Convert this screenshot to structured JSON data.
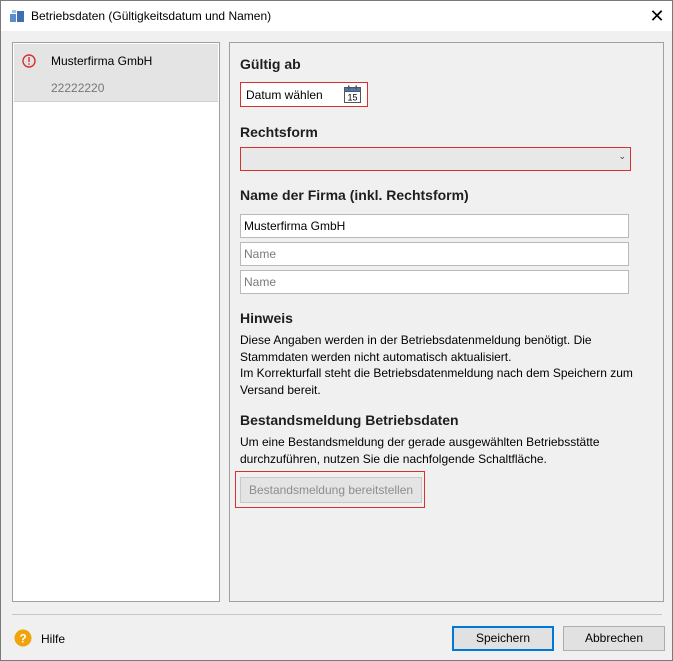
{
  "window": {
    "title": "Betriebsdaten (Gültigkeitsdatum und Namen)",
    "close_glyph": "✕"
  },
  "sidebar": {
    "items": [
      {
        "name": "Musterfirma GmbH",
        "number": "22222220",
        "status_icon": "error-circle-icon"
      }
    ]
  },
  "form": {
    "valid_from": {
      "heading": "Gültig ab",
      "date_label": "Datum wählen",
      "calendar_day": "15"
    },
    "legal_form": {
      "heading": "Rechtsform",
      "selected": ""
    },
    "company_name": {
      "heading": "Name der Firma (inkl. Rechtsform)",
      "line1_value": "Musterfirma GmbH",
      "line2_placeholder": "Name",
      "line3_placeholder": "Name"
    },
    "note": {
      "heading": "Hinweis",
      "line1": "Diese Angaben werden in der Betriebsdatenmeldung benötigt. Die",
      "line2": "Stammdaten werden nicht automatisch aktualisiert.",
      "line3": "Im Korrekturfall steht die Betriebsdatenmeldung nach dem Speichern zum",
      "line4": "Versand bereit."
    },
    "inventory": {
      "heading": "Bestandsmeldung Betriebsdaten",
      "line1": "Um eine Bestandsmeldung der gerade ausgewählten Betriebsstätte",
      "line2": "durchzuführen, nutzen Sie die nachfolgende Schaltfläche.",
      "button_label": "Bestandsmeldung bereitstellen"
    }
  },
  "footer": {
    "help_label": "Hilfe",
    "save_label": "Speichern",
    "cancel_label": "Abbrechen"
  },
  "colors": {
    "error_red": "#d6312f",
    "accent_blue": "#0078d7",
    "help_orange": "#f0a30a"
  }
}
